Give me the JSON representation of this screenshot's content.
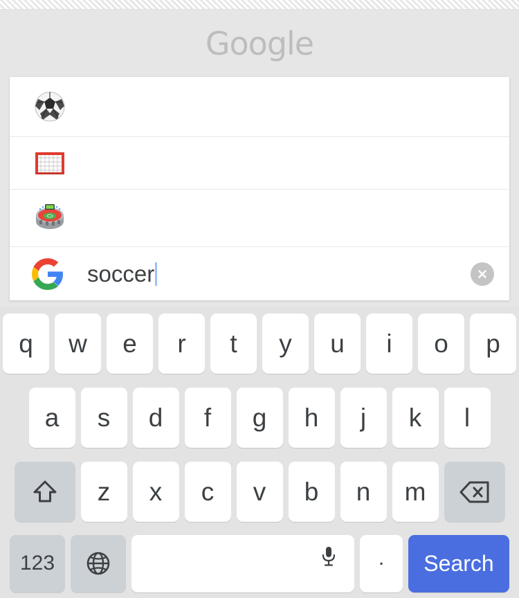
{
  "header": {
    "wordmark": "Google"
  },
  "suggestions": [
    {
      "icon": "soccer-ball-emoji",
      "label": ""
    },
    {
      "icon": "goal-net-emoji",
      "label": ""
    },
    {
      "icon": "stadium-emoji",
      "label": ""
    }
  ],
  "search": {
    "logo_icon": "google-g-logo",
    "query": "soccer",
    "placeholder": "Search",
    "clear_icon": "clear-circle-icon"
  },
  "keyboard": {
    "row1": [
      "q",
      "w",
      "e",
      "r",
      "t",
      "y",
      "u",
      "i",
      "o",
      "p"
    ],
    "row2": [
      "a",
      "s",
      "d",
      "f",
      "g",
      "h",
      "j",
      "k",
      "l"
    ],
    "row3": [
      "z",
      "x",
      "c",
      "v",
      "b",
      "n",
      "m"
    ],
    "shift_icon": "shift-arrow-icon",
    "backspace_icon": "backspace-delete-icon",
    "numeric_label": "123",
    "globe_icon": "globe-language-icon",
    "space_label": "",
    "mic_icon": "microphone-icon",
    "period_label": ".",
    "search_label": "Search"
  },
  "colors": {
    "page_background": "#e6e6e6",
    "keyboard_background": "#e3e3e3",
    "key_face": "#ffffff",
    "key_special": "#ccd1d6",
    "search_button": "#4a6ee0",
    "key_text": "#3c4043",
    "wordmark": "#bdbdbd",
    "caret": "#9cc2f0"
  }
}
